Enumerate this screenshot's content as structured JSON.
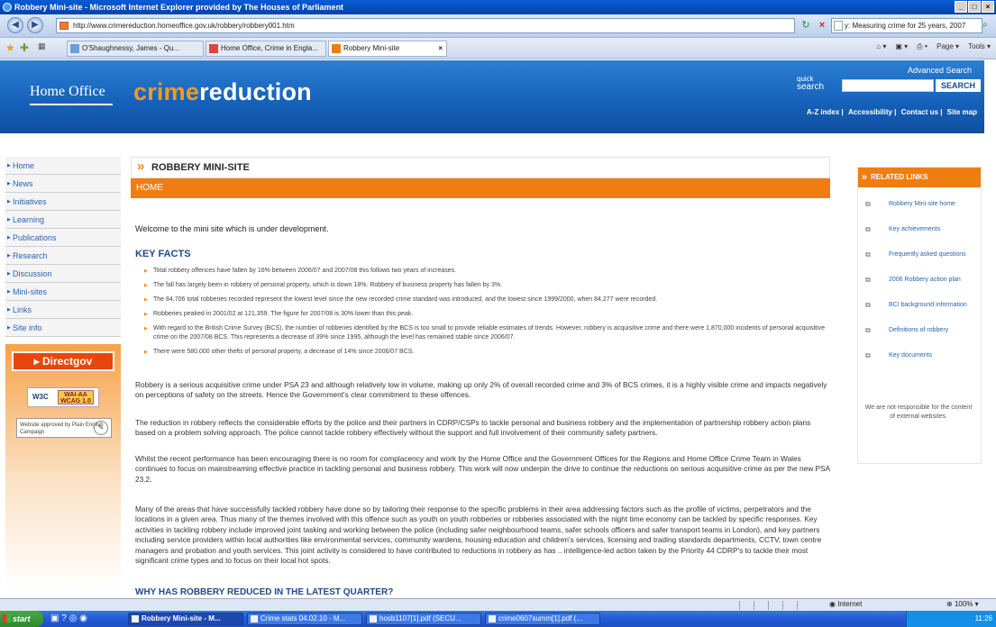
{
  "browser": {
    "title": "Robbery Mini-site - Microsoft Internet Explorer provided by The Houses of Parliament",
    "url": "http://www.crimereduction.homeoffice.gov.uk/robbery/robbery001.htm",
    "search_value": "y: Measuring crime for 25 years, 2007",
    "tabs": [
      {
        "label": "O'Shaughnessy, James - Qu..."
      },
      {
        "label": "Home Office, Crime in Engla..."
      },
      {
        "label": "Robbery Mini-site"
      }
    ],
    "tools": {
      "page": "Page",
      "tools": "Tools"
    },
    "status": {
      "zone": "Internet",
      "zoom": "100%"
    }
  },
  "header": {
    "logo": "Home Office",
    "brand_prefix": "crime",
    "brand_suffix": "reduction",
    "advanced_search": "Advanced Search",
    "quick_line1": "quick",
    "quick_line2": "search",
    "search_button": "SEARCH",
    "links": [
      "A-Z index",
      "Accessibility",
      "Contact us",
      "Site map"
    ]
  },
  "sidebar": {
    "items": [
      {
        "label": "Home"
      },
      {
        "label": "News"
      },
      {
        "label": "Initiatives"
      },
      {
        "label": "Learning"
      },
      {
        "label": "Publications"
      },
      {
        "label": "Research"
      },
      {
        "label": "Discussion"
      },
      {
        "label": "Mini-sites"
      },
      {
        "label": "Links"
      },
      {
        "label": "Site info"
      }
    ],
    "directgov": "Directgov",
    "wai_prefix": "W3C",
    "wai": "WAI-AA",
    "wcag": "WCAG 1.0",
    "plain_english": "Website approved by Plain English Campaign"
  },
  "main": {
    "title": "ROBBERY MINI-SITE",
    "section": "HOME",
    "welcome": "Welcome to the mini site which is under development.",
    "key_facts_title": "KEY FACTS",
    "facts": [
      "Total robbery offences have fallen by 16% between 2006/07 and 2007/08 this follows two years of increases.",
      "The fall has largely been in robbery of personal property, which is down 18%. Robbery of business property has fallen by 3%.",
      "The 84,706 total robberies recorded represent the lowest level since the new recorded crime standard was introduced, and the lowest since 1999/2000, when 84,277 were recorded.",
      "Robberies peaked in 2001/02 at 121,359. The figure for 2007/08 is 30% lower than this peak.",
      "With regard to the British Crime Survey (BCS), the number of robberies identified by the BCS is too small to provide reliable estimates of trends. However, robbery is acquisitive crime and there were 1,870,000 incidents of personal acquisitive crime on the 2007/08 BCS. This represents a decrease of 39% since 1995, although the level has remained stable since 2006/07.",
      "There were 580,000 other thefts of personal property, a decrease of 14% since 2006/07 BCS."
    ],
    "paragraphs": [
      "Robbery is a serious acquisitive crime under PSA 23 and although relatively low in volume, making up only 2% of overall recorded crime and 3% of BCS crimes, it is a highly visible crime and impacts negatively on perceptions of safety on the streets. Hence the Government's clear commitment to these offences.",
      "The reduction in robbery reflects the considerable efforts by the police and their partners in CDRP/CSPs to tackle personal and business robbery and the implementation of partnership robbery action plans based on a problem solving approach. The police cannot tackle robbery effectively without the support and full involvement of their community safety partners.",
      "Whilst the recent performance has been encouraging there is no room for complacency and work by the Home Office and the Government Offices for the Regions and Home Office Crime Team in Wales continues to focus on mainstreaming effective practice in tackling personal and business robbery. This work will now underpin the drive to continue the reductions on serious acquisitive crime as per the new PSA 23.2.",
      "Many of the areas that have successfully tackled robbery have done so by tailoring their response to the specific problems in their area addressing factors such as the profile of victims, perpetrators and the locations in a given area. Thus many of the themes involved with this offence such as youth on youth robberies or robberies associated with the night time economy can be tackled by specific responses. Key activities in tackling robbery include improved joint tasking and working between the police (including safer neighbourhood teams, safer schools officers and safer transport teams in London), and key partners including service providers within local authorities like environmental services, community wardens, housing education and children's services, licensing and trading standards departments, CCTV, town centre managers and probation and youth services. This joint activity is considered to have contributed to reductions in robbery as has .. intelligence-led action taken by the Priority 44 CDRP's to tackle their most significant crime types and to focus on their local hot spots."
    ],
    "next_heading": "WHY HAS ROBBERY REDUCED IN THE LATEST QUARTER?"
  },
  "related": {
    "title": "RELATED LINKS",
    "links": [
      {
        "label": "Robbery Mini-site home"
      },
      {
        "label": "Key achievements"
      },
      {
        "label": "Frequently asked questions"
      },
      {
        "label": "2006 Robbery action plan"
      },
      {
        "label": "BCI background information"
      },
      {
        "label": "Definitions of robbery"
      },
      {
        "label": "Key documents"
      }
    ],
    "note": "We are not responsible for the content of external websites."
  },
  "taskbar": {
    "start": "start",
    "tasks": [
      {
        "label": "Robbery Mini-site - M..."
      },
      {
        "label": "Crime stats 04.02.10 - M..."
      },
      {
        "label": "hosb1107[1].pdf (SECU..."
      },
      {
        "label": "crime0607summ[1].pdf (..."
      }
    ],
    "clock": "11:26"
  },
  "colors": {
    "accent": "#f07d10",
    "header_blue": "#1560b8",
    "link": "#2a63b0"
  }
}
